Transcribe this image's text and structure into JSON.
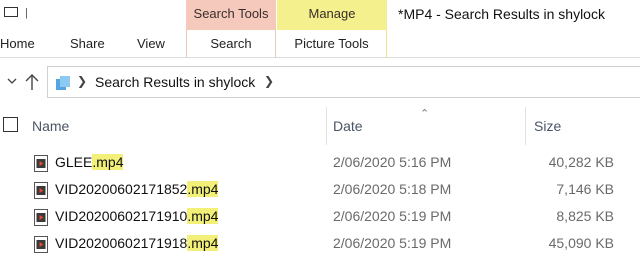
{
  "window": {
    "title": "*MP4 - Search Results in shylock",
    "contextual_tabs": {
      "search_tools": "Search Tools",
      "manage": "Manage"
    },
    "colors": {
      "search_tools_bg": "#f6c9bd",
      "manage_bg": "#f5f08e",
      "highlight": "#f3f07a"
    }
  },
  "ribbon": {
    "tabs": [
      "Home",
      "Share",
      "View"
    ],
    "search_tab": "Search",
    "picture_tools_tab": "Picture Tools"
  },
  "address": {
    "path": "Search Results in shylock"
  },
  "columns": {
    "name": "Name",
    "date": "Date",
    "size": "Size"
  },
  "files": [
    {
      "name_base": "GLEE",
      "name_ext": ".mp4",
      "date": "2/06/2020 5:16 PM",
      "size": "40,282 KB"
    },
    {
      "name_base": "VID20200602171852",
      "name_ext": ".mp4",
      "date": "2/06/2020 5:18 PM",
      "size": "7,146 KB"
    },
    {
      "name_base": "VID20200602171910",
      "name_ext": ".mp4",
      "date": "2/06/2020 5:19 PM",
      "size": "8,825 KB"
    },
    {
      "name_base": "VID20200602171918",
      "name_ext": ".mp4",
      "date": "2/06/2020 5:19 PM",
      "size": "45,090 KB"
    }
  ]
}
